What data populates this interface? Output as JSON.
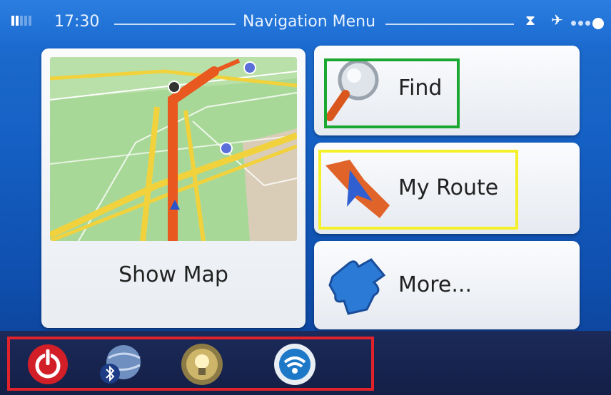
{
  "status_bar": {
    "time": "17:30",
    "title": "Navigation Menu"
  },
  "tiles": {
    "show_map": {
      "label": "Show Map",
      "icon": "map-preview"
    },
    "find": {
      "label": "Find",
      "icon": "magnifier-icon"
    },
    "my_route": {
      "label": "My Route",
      "icon": "route-arrow-icon"
    },
    "more": {
      "label": "More...",
      "icon": "puzzle-icon"
    }
  },
  "quick_buttons": [
    {
      "name": "power",
      "icon": "power-icon"
    },
    {
      "name": "bluetooth",
      "icon": "bluetooth-globe-icon"
    },
    {
      "name": "light",
      "icon": "lightbulb-icon"
    },
    {
      "name": "wifi",
      "icon": "wifi-icon"
    }
  ],
  "highlight_colors": {
    "find": "#1aa832",
    "my_route": "#f4f02a",
    "quick_bar": "#e0232b"
  }
}
